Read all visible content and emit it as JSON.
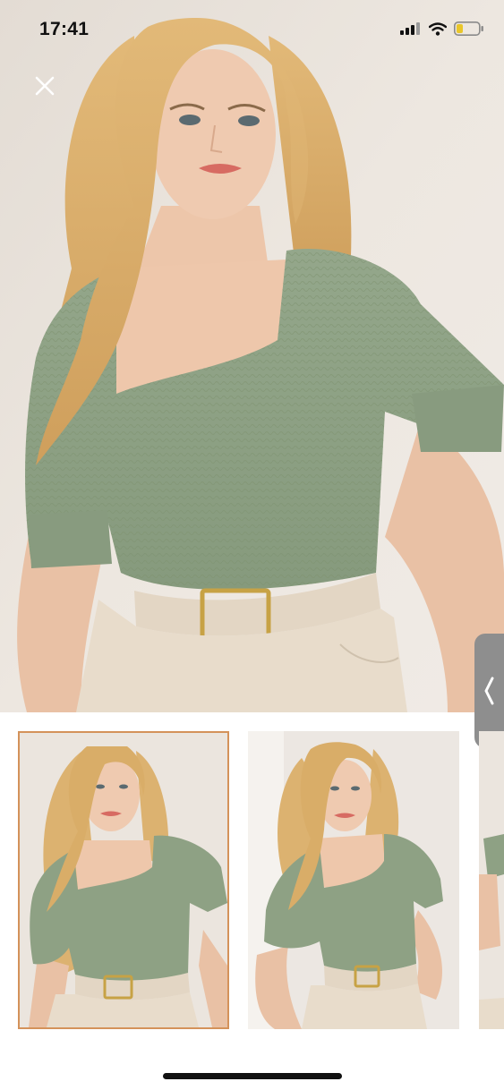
{
  "status_bar": {
    "time": "17:41",
    "icons": [
      "cellular-signal-icon",
      "wifi-icon",
      "battery-low-icon"
    ]
  },
  "viewer": {
    "close_icon": "close-icon",
    "side_tab_icon": "chevron-left-icon",
    "hero_image": "product-photo-model-sage-green-square-neck-top",
    "thumbnails": [
      {
        "image": "model-front-pose",
        "selected": true
      },
      {
        "image": "model-side-pose",
        "selected": false
      },
      {
        "image": "model-partial",
        "selected": false
      }
    ]
  },
  "colors": {
    "top_green": "#8ea184",
    "skirt_beige": "#e8dccb",
    "hair_blonde": "#dcb270",
    "selected_border": "#d4925a",
    "background": "#ebe4dc"
  }
}
